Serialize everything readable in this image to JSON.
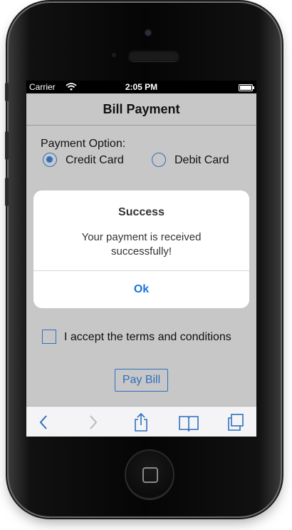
{
  "status_bar": {
    "carrier": "Carrier",
    "time": "2:05 PM"
  },
  "nav": {
    "title": "Bill Payment"
  },
  "form": {
    "payment_option_label": "Payment Option:",
    "options": [
      {
        "label": "Credit Card",
        "selected": true
      },
      {
        "label": "Debit Card",
        "selected": false
      }
    ],
    "terms_label": "I accept the terms and conditions",
    "terms_checked": false,
    "pay_button_label": "Pay Bill"
  },
  "alert": {
    "title": "Success",
    "message": "Your payment is received successfully!",
    "ok_label": "Ok"
  },
  "toolbar": {
    "items": [
      "back-icon",
      "forward-icon",
      "share-icon",
      "bookmarks-icon",
      "tabs-icon"
    ]
  },
  "colors": {
    "accent": "#2f6fbf",
    "alert_button": "#1a73d9",
    "screen_background": "#c7c7c7"
  }
}
